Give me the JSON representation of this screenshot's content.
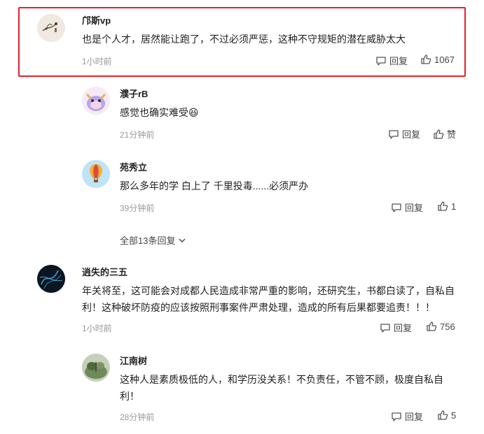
{
  "comments": [
    {
      "username": "邝斯vp",
      "text": "也是个人才，居然能让跑了，不过必须严惩，这种不守规矩的潜在威胁太大",
      "time": "1小时前",
      "reply_label": "回复",
      "like_count": "1067",
      "highlighted": true
    },
    {
      "username": "濮子rB",
      "text": "感觉也确实难受😆",
      "time": "21分钟前",
      "reply_label": "回复",
      "like_label": "赞"
    },
    {
      "username": "苑秀立",
      "text": "那么多年的学 白上了 千里投毒......必须严办",
      "time": "39分钟前",
      "reply_label": "回复",
      "like_count": "1"
    },
    {
      "username": "逍失的三五",
      "text": "年关将至，这可能会对成都人民造成非常严重的影响，还研究生，书都白读了，自私自利！这种破坏防疫的应该按照刑事案件严肃处理，造成的所有后果都要追责！！！",
      "time": "1小时前",
      "reply_label": "回复",
      "like_count": "756"
    },
    {
      "username": "江南树",
      "text": "这种人是素质极低的人，和学历没关系！不负责任，不管不顾，极度自私自利！",
      "time": "28分钟前",
      "reply_label": "回复",
      "like_count": "5"
    }
  ],
  "expand_replies_label": "全部13条回复",
  "colors": {
    "highlight_border": "#e0232b",
    "muted": "#999999"
  }
}
